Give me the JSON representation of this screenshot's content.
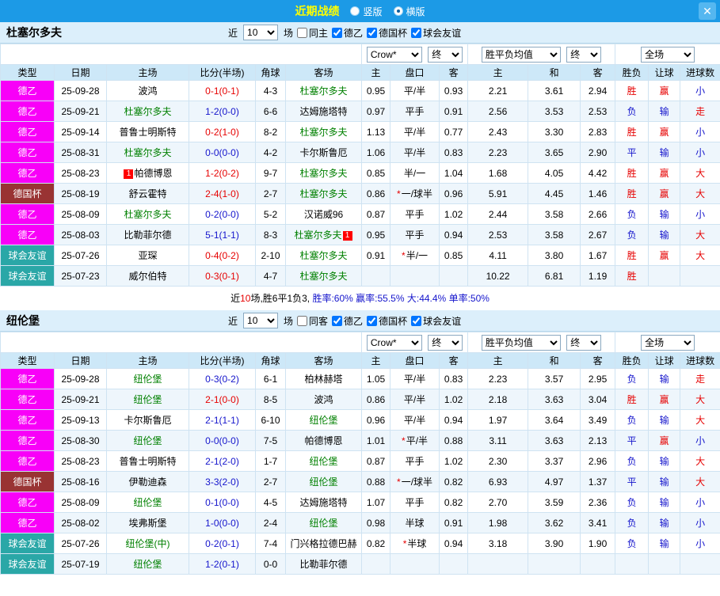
{
  "colors": {
    "red": "#e60000",
    "blue": "#1414cc",
    "green": "#008000",
    "black": "#000000"
  },
  "value_colors": {
    "胜": "red",
    "负": "blue",
    "平": "blue",
    "赢": "red",
    "输": "blue",
    "大": "red",
    "小": "blue",
    "走": "red"
  },
  "type_colors": {
    "德乙": "#f800f8",
    "德国杯": "#993333",
    "球会友谊": "#2aa7a7"
  },
  "titlebar": {
    "title": "近期战绩",
    "radio_vertical": "竖版",
    "radio_horizontal": "横版",
    "vertical_on": false,
    "horizontal_on": true,
    "close": "✕"
  },
  "filters": {
    "near": "近",
    "count": "10",
    "games": "场",
    "bookmaker": "Crow*",
    "final": "终",
    "avg": "胜平负均值",
    "scope": "全场"
  },
  "columns": {
    "type": "类型",
    "date": "日期",
    "home": "主场",
    "score": "比分(半场)",
    "corner": "角球",
    "away": "客场",
    "ohome": "主",
    "line": "盘口",
    "oaway": "客",
    "ahome": "主",
    "adraw": "和",
    "aaway": "客",
    "result": "胜负",
    "handicap": "让球",
    "goals": "进球数"
  },
  "sections": [
    {
      "team": "杜塞尔多夫",
      "same": "同主",
      "same_on": false,
      "leagues": [
        {
          "label": "德乙",
          "on": true
        },
        {
          "label": "德国杯",
          "on": true
        },
        {
          "label": "球会友谊",
          "on": true
        }
      ],
      "rows": [
        {
          "type": "德乙",
          "date": "25-09-28",
          "home": "波鸿",
          "home_green": false,
          "home_badge": "",
          "score": "0-1(0-1)",
          "score_color": "red",
          "corner": "4-3",
          "away": "杜塞尔多夫",
          "away_green": true,
          "away_badge": "",
          "o1": "0.95",
          "star": false,
          "line": "平/半",
          "o2": "0.93",
          "a1": "2.21",
          "a2": "3.61",
          "a3": "2.94",
          "result": "胜",
          "handicap": "赢",
          "goals": "小"
        },
        {
          "type": "德乙",
          "date": "25-09-21",
          "home": "杜塞尔多夫",
          "home_green": true,
          "home_badge": "",
          "score": "1-2(0-0)",
          "score_color": "blue",
          "corner": "6-6",
          "away": "达姆施塔特",
          "away_green": false,
          "away_badge": "",
          "o1": "0.97",
          "star": false,
          "line": "平手",
          "o2": "0.91",
          "a1": "2.56",
          "a2": "3.53",
          "a3": "2.53",
          "result": "负",
          "handicap": "输",
          "goals": "走"
        },
        {
          "type": "德乙",
          "date": "25-09-14",
          "home": "普鲁士明斯特",
          "home_green": false,
          "home_badge": "",
          "score": "0-2(1-0)",
          "score_color": "red",
          "corner": "8-2",
          "away": "杜塞尔多夫",
          "away_green": true,
          "away_badge": "",
          "o1": "1.13",
          "star": false,
          "line": "平/半",
          "o2": "0.77",
          "a1": "2.43",
          "a2": "3.30",
          "a3": "2.83",
          "result": "胜",
          "handicap": "赢",
          "goals": "小"
        },
        {
          "type": "德乙",
          "date": "25-08-31",
          "home": "杜塞尔多夫",
          "home_green": true,
          "home_badge": "",
          "score": "0-0(0-0)",
          "score_color": "blue",
          "corner": "4-2",
          "away": "卡尔斯鲁厄",
          "away_green": false,
          "away_badge": "",
          "o1": "1.06",
          "star": false,
          "line": "平/半",
          "o2": "0.83",
          "a1": "2.23",
          "a2": "3.65",
          "a3": "2.90",
          "result": "平",
          "handicap": "输",
          "goals": "小"
        },
        {
          "type": "德乙",
          "date": "25-08-23",
          "home": "帕德博恩",
          "home_green": false,
          "home_badge": "1",
          "score": "1-2(0-2)",
          "score_color": "red",
          "corner": "9-7",
          "away": "杜塞尔多夫",
          "away_green": true,
          "away_badge": "",
          "o1": "0.85",
          "star": false,
          "line": "半/一",
          "o2": "1.04",
          "a1": "1.68",
          "a2": "4.05",
          "a3": "4.42",
          "result": "胜",
          "handicap": "赢",
          "goals": "大"
        },
        {
          "type": "德国杯",
          "date": "25-08-19",
          "home": "舒云霍特",
          "home_green": false,
          "home_badge": "",
          "score": "2-4(1-0)",
          "score_color": "red",
          "corner": "2-7",
          "away": "杜塞尔多夫",
          "away_green": true,
          "away_badge": "",
          "o1": "0.86",
          "star": true,
          "line": "一/球半",
          "o2": "0.96",
          "a1": "5.91",
          "a2": "4.45",
          "a3": "1.46",
          "result": "胜",
          "handicap": "赢",
          "goals": "大"
        },
        {
          "type": "德乙",
          "date": "25-08-09",
          "home": "杜塞尔多夫",
          "home_green": true,
          "home_badge": "",
          "score": "0-2(0-0)",
          "score_color": "blue",
          "corner": "5-2",
          "away": "汉诺威96",
          "away_green": false,
          "away_badge": "",
          "o1": "0.87",
          "star": false,
          "line": "平手",
          "o2": "1.02",
          "a1": "2.44",
          "a2": "3.58",
          "a3": "2.66",
          "result": "负",
          "handicap": "输",
          "goals": "小"
        },
        {
          "type": "德乙",
          "date": "25-08-03",
          "home": "比勒菲尔德",
          "home_green": false,
          "home_badge": "",
          "score": "5-1(1-1)",
          "score_color": "blue",
          "corner": "8-3",
          "away": "杜塞尔多夫",
          "away_green": true,
          "away_badge": "1",
          "o1": "0.95",
          "star": false,
          "line": "平手",
          "o2": "0.94",
          "a1": "2.53",
          "a2": "3.58",
          "a3": "2.67",
          "result": "负",
          "handicap": "输",
          "goals": "大"
        },
        {
          "type": "球会友谊",
          "date": "25-07-26",
          "home": "亚琛",
          "home_green": false,
          "home_badge": "",
          "score": "0-4(0-2)",
          "score_color": "red",
          "corner": "2-10",
          "away": "杜塞尔多夫",
          "away_green": true,
          "away_badge": "",
          "o1": "0.91",
          "star": true,
          "line": "半/一",
          "o2": "0.85",
          "a1": "4.11",
          "a2": "3.80",
          "a3": "1.67",
          "result": "胜",
          "handicap": "赢",
          "goals": "大"
        },
        {
          "type": "球会友谊",
          "date": "25-07-23",
          "home": "威尔伯特",
          "home_green": false,
          "home_badge": "",
          "score": "0-3(0-1)",
          "score_color": "red",
          "corner": "4-7",
          "away": "杜塞尔多夫",
          "away_green": true,
          "away_badge": "",
          "o1": "",
          "star": false,
          "line": "",
          "o2": "",
          "a1": "10.22",
          "a2": "6.81",
          "a3": "1.19",
          "result": "胜",
          "handicap": "",
          "goals": ""
        }
      ],
      "summary": [
        {
          "t": "近",
          "c": "black"
        },
        {
          "t": "10",
          "c": "red"
        },
        {
          "t": "场,胜6平1负3, ",
          "c": "black"
        },
        {
          "t": "胜率:60% ",
          "c": "blue"
        },
        {
          "t": "赢率:55.5% ",
          "c": "blue"
        },
        {
          "t": "大:44.4% ",
          "c": "blue"
        },
        {
          "t": "单率:50%",
          "c": "blue"
        }
      ]
    },
    {
      "team": "纽伦堡",
      "same": "同客",
      "same_on": false,
      "leagues": [
        {
          "label": "德乙",
          "on": true
        },
        {
          "label": "德国杯",
          "on": true
        },
        {
          "label": "球会友谊",
          "on": true
        }
      ],
      "rows": [
        {
          "type": "德乙",
          "date": "25-09-28",
          "home": "纽伦堡",
          "home_green": true,
          "home_badge": "",
          "score": "0-3(0-2)",
          "score_color": "blue",
          "corner": "6-1",
          "away": "柏林赫塔",
          "away_green": false,
          "away_badge": "",
          "o1": "1.05",
          "star": false,
          "line": "平/半",
          "o2": "0.83",
          "a1": "2.23",
          "a2": "3.57",
          "a3": "2.95",
          "result": "负",
          "handicap": "输",
          "goals": "走"
        },
        {
          "type": "德乙",
          "date": "25-09-21",
          "home": "纽伦堡",
          "home_green": true,
          "home_badge": "",
          "score": "2-1(0-0)",
          "score_color": "red",
          "corner": "8-5",
          "away": "波鸿",
          "away_green": false,
          "away_badge": "",
          "o1": "0.86",
          "star": false,
          "line": "平/半",
          "o2": "1.02",
          "a1": "2.18",
          "a2": "3.63",
          "a3": "3.04",
          "result": "胜",
          "handicap": "赢",
          "goals": "大"
        },
        {
          "type": "德乙",
          "date": "25-09-13",
          "home": "卡尔斯鲁厄",
          "home_green": false,
          "home_badge": "",
          "score": "2-1(1-1)",
          "score_color": "blue",
          "corner": "6-10",
          "away": "纽伦堡",
          "away_green": true,
          "away_badge": "",
          "o1": "0.96",
          "star": false,
          "line": "平/半",
          "o2": "0.94",
          "a1": "1.97",
          "a2": "3.64",
          "a3": "3.49",
          "result": "负",
          "handicap": "输",
          "goals": "大"
        },
        {
          "type": "德乙",
          "date": "25-08-30",
          "home": "纽伦堡",
          "home_green": true,
          "home_badge": "",
          "score": "0-0(0-0)",
          "score_color": "blue",
          "corner": "7-5",
          "away": "帕德博恩",
          "away_green": false,
          "away_badge": "",
          "o1": "1.01",
          "star": true,
          "line": "平/半",
          "o2": "0.88",
          "a1": "3.11",
          "a2": "3.63",
          "a3": "2.13",
          "result": "平",
          "handicap": "赢",
          "goals": "小"
        },
        {
          "type": "德乙",
          "date": "25-08-23",
          "home": "普鲁士明斯特",
          "home_green": false,
          "home_badge": "",
          "score": "2-1(2-0)",
          "score_color": "blue",
          "corner": "1-7",
          "away": "纽伦堡",
          "away_green": true,
          "away_badge": "",
          "o1": "0.87",
          "star": false,
          "line": "平手",
          "o2": "1.02",
          "a1": "2.30",
          "a2": "3.37",
          "a3": "2.96",
          "result": "负",
          "handicap": "输",
          "goals": "大"
        },
        {
          "type": "德国杯",
          "date": "25-08-16",
          "home": "伊勒迪森",
          "home_green": false,
          "home_badge": "",
          "score": "3-3(2-0)",
          "score_color": "blue",
          "corner": "2-7",
          "away": "纽伦堡",
          "away_green": true,
          "away_badge": "",
          "o1": "0.88",
          "star": true,
          "line": "一/球半",
          "o2": "0.82",
          "a1": "6.93",
          "a2": "4.97",
          "a3": "1.37",
          "result": "平",
          "handicap": "输",
          "goals": "大"
        },
        {
          "type": "德乙",
          "date": "25-08-09",
          "home": "纽伦堡",
          "home_green": true,
          "home_badge": "",
          "score": "0-1(0-0)",
          "score_color": "blue",
          "corner": "4-5",
          "away": "达姆施塔特",
          "away_green": false,
          "away_badge": "",
          "o1": "1.07",
          "star": false,
          "line": "平手",
          "o2": "0.82",
          "a1": "2.70",
          "a2": "3.59",
          "a3": "2.36",
          "result": "负",
          "handicap": "输",
          "goals": "小"
        },
        {
          "type": "德乙",
          "date": "25-08-02",
          "home": "埃弗斯堡",
          "home_green": false,
          "home_badge": "",
          "score": "1-0(0-0)",
          "score_color": "blue",
          "corner": "2-4",
          "away": "纽伦堡",
          "away_green": true,
          "away_badge": "",
          "o1": "0.98",
          "star": false,
          "line": "半球",
          "o2": "0.91",
          "a1": "1.98",
          "a2": "3.62",
          "a3": "3.41",
          "result": "负",
          "handicap": "输",
          "goals": "小"
        },
        {
          "type": "球会友谊",
          "date": "25-07-26",
          "home": "纽伦堡(中)",
          "home_green": true,
          "home_badge": "",
          "score": "0-2(0-1)",
          "score_color": "blue",
          "corner": "7-4",
          "away": "门兴格拉德巴赫",
          "away_green": false,
          "away_badge": "",
          "o1": "0.82",
          "star": true,
          "line": "半球",
          "o2": "0.94",
          "a1": "3.18",
          "a2": "3.90",
          "a3": "1.90",
          "result": "负",
          "handicap": "输",
          "goals": "小"
        },
        {
          "type": "球会友谊",
          "date": "25-07-19",
          "home": "纽伦堡",
          "home_green": true,
          "home_badge": "",
          "score": "1-2(0-1)",
          "score_color": "blue",
          "corner": "0-0",
          "away": "比勒菲尔德",
          "away_green": false,
          "away_badge": "",
          "o1": "",
          "star": false,
          "line": "",
          "o2": "",
          "a1": "",
          "a2": "",
          "a3": "",
          "result": "",
          "handicap": "",
          "goals": ""
        }
      ],
      "summary": []
    }
  ]
}
